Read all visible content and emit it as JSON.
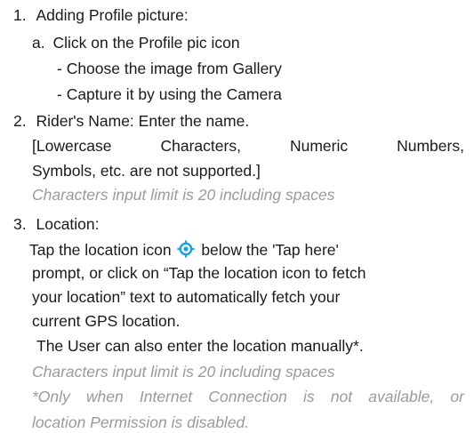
{
  "instructions": {
    "item1": {
      "number": "1.",
      "title": "Adding Profile picture:",
      "sub_letter": "a.",
      "sub_text": "Click on the Profile pic icon",
      "bullet1": "- Choose the image from Gallery",
      "bullet2": "- Capture it by using the Camera"
    },
    "item2": {
      "number": "2.",
      "title": "Rider's Name: Enter the name.",
      "constraint_words": [
        "[Lowercase",
        "Characters,",
        "Numeric",
        "Numbers,"
      ],
      "constraint_line2": "Symbols, etc. are not supported.]",
      "limit_note": "Characters input limit is 20 including spaces"
    },
    "item3": {
      "number": "3.",
      "title": "Location:",
      "line1a": "Tap the location icon",
      "line1b": "below the 'Tap here'",
      "line2": "prompt, or click on “Tap the location icon to fetch",
      "line3": "your location” text  to automatically fetch your",
      "line4": "current GPS location.",
      "manual": "The User can also enter the location manually*.",
      "limit_note": "Characters input limit is 20 including spaces",
      "footnote_words": [
        "*Only",
        "when",
        "Internet",
        "Connection",
        "is",
        "not",
        "available,",
        "or"
      ],
      "footnote_line2": "location Permission is disabled."
    },
    "colors": {
      "text": "#1a1a1a",
      "note": "#9a9a9a",
      "location_icon": "#1ba4de"
    },
    "icons": {
      "location": "gps-target-icon"
    }
  }
}
